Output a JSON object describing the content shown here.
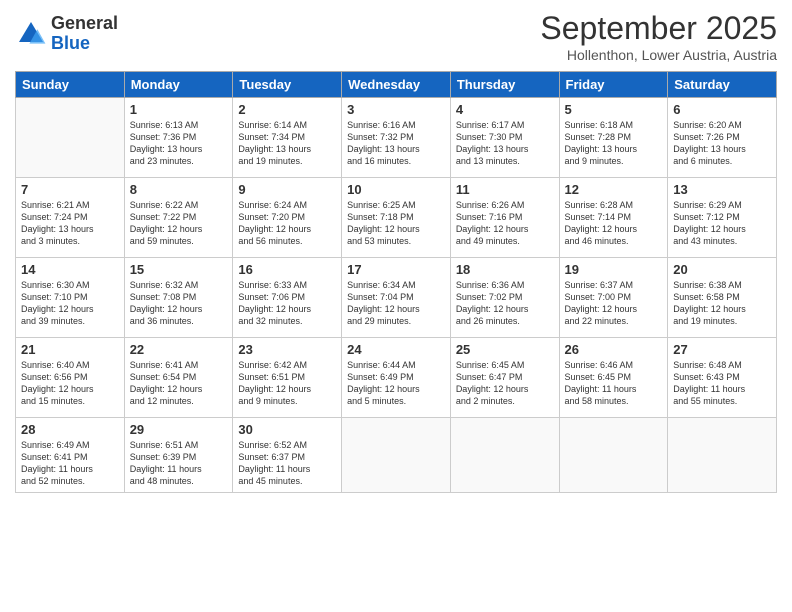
{
  "logo": {
    "general": "General",
    "blue": "Blue"
  },
  "header": {
    "month": "September 2025",
    "location": "Hollenthon, Lower Austria, Austria"
  },
  "days_header": [
    "Sunday",
    "Monday",
    "Tuesday",
    "Wednesday",
    "Thursday",
    "Friday",
    "Saturday"
  ],
  "weeks": [
    [
      {
        "day": "",
        "info": ""
      },
      {
        "day": "1",
        "info": "Sunrise: 6:13 AM\nSunset: 7:36 PM\nDaylight: 13 hours\nand 23 minutes."
      },
      {
        "day": "2",
        "info": "Sunrise: 6:14 AM\nSunset: 7:34 PM\nDaylight: 13 hours\nand 19 minutes."
      },
      {
        "day": "3",
        "info": "Sunrise: 6:16 AM\nSunset: 7:32 PM\nDaylight: 13 hours\nand 16 minutes."
      },
      {
        "day": "4",
        "info": "Sunrise: 6:17 AM\nSunset: 7:30 PM\nDaylight: 13 hours\nand 13 minutes."
      },
      {
        "day": "5",
        "info": "Sunrise: 6:18 AM\nSunset: 7:28 PM\nDaylight: 13 hours\nand 9 minutes."
      },
      {
        "day": "6",
        "info": "Sunrise: 6:20 AM\nSunset: 7:26 PM\nDaylight: 13 hours\nand 6 minutes."
      }
    ],
    [
      {
        "day": "7",
        "info": "Sunrise: 6:21 AM\nSunset: 7:24 PM\nDaylight: 13 hours\nand 3 minutes."
      },
      {
        "day": "8",
        "info": "Sunrise: 6:22 AM\nSunset: 7:22 PM\nDaylight: 12 hours\nand 59 minutes."
      },
      {
        "day": "9",
        "info": "Sunrise: 6:24 AM\nSunset: 7:20 PM\nDaylight: 12 hours\nand 56 minutes."
      },
      {
        "day": "10",
        "info": "Sunrise: 6:25 AM\nSunset: 7:18 PM\nDaylight: 12 hours\nand 53 minutes."
      },
      {
        "day": "11",
        "info": "Sunrise: 6:26 AM\nSunset: 7:16 PM\nDaylight: 12 hours\nand 49 minutes."
      },
      {
        "day": "12",
        "info": "Sunrise: 6:28 AM\nSunset: 7:14 PM\nDaylight: 12 hours\nand 46 minutes."
      },
      {
        "day": "13",
        "info": "Sunrise: 6:29 AM\nSunset: 7:12 PM\nDaylight: 12 hours\nand 43 minutes."
      }
    ],
    [
      {
        "day": "14",
        "info": "Sunrise: 6:30 AM\nSunset: 7:10 PM\nDaylight: 12 hours\nand 39 minutes."
      },
      {
        "day": "15",
        "info": "Sunrise: 6:32 AM\nSunset: 7:08 PM\nDaylight: 12 hours\nand 36 minutes."
      },
      {
        "day": "16",
        "info": "Sunrise: 6:33 AM\nSunset: 7:06 PM\nDaylight: 12 hours\nand 32 minutes."
      },
      {
        "day": "17",
        "info": "Sunrise: 6:34 AM\nSunset: 7:04 PM\nDaylight: 12 hours\nand 29 minutes."
      },
      {
        "day": "18",
        "info": "Sunrise: 6:36 AM\nSunset: 7:02 PM\nDaylight: 12 hours\nand 26 minutes."
      },
      {
        "day": "19",
        "info": "Sunrise: 6:37 AM\nSunset: 7:00 PM\nDaylight: 12 hours\nand 22 minutes."
      },
      {
        "day": "20",
        "info": "Sunrise: 6:38 AM\nSunset: 6:58 PM\nDaylight: 12 hours\nand 19 minutes."
      }
    ],
    [
      {
        "day": "21",
        "info": "Sunrise: 6:40 AM\nSunset: 6:56 PM\nDaylight: 12 hours\nand 15 minutes."
      },
      {
        "day": "22",
        "info": "Sunrise: 6:41 AM\nSunset: 6:54 PM\nDaylight: 12 hours\nand 12 minutes."
      },
      {
        "day": "23",
        "info": "Sunrise: 6:42 AM\nSunset: 6:51 PM\nDaylight: 12 hours\nand 9 minutes."
      },
      {
        "day": "24",
        "info": "Sunrise: 6:44 AM\nSunset: 6:49 PM\nDaylight: 12 hours\nand 5 minutes."
      },
      {
        "day": "25",
        "info": "Sunrise: 6:45 AM\nSunset: 6:47 PM\nDaylight: 12 hours\nand 2 minutes."
      },
      {
        "day": "26",
        "info": "Sunrise: 6:46 AM\nSunset: 6:45 PM\nDaylight: 11 hours\nand 58 minutes."
      },
      {
        "day": "27",
        "info": "Sunrise: 6:48 AM\nSunset: 6:43 PM\nDaylight: 11 hours\nand 55 minutes."
      }
    ],
    [
      {
        "day": "28",
        "info": "Sunrise: 6:49 AM\nSunset: 6:41 PM\nDaylight: 11 hours\nand 52 minutes."
      },
      {
        "day": "29",
        "info": "Sunrise: 6:51 AM\nSunset: 6:39 PM\nDaylight: 11 hours\nand 48 minutes."
      },
      {
        "day": "30",
        "info": "Sunrise: 6:52 AM\nSunset: 6:37 PM\nDaylight: 11 hours\nand 45 minutes."
      },
      {
        "day": "",
        "info": ""
      },
      {
        "day": "",
        "info": ""
      },
      {
        "day": "",
        "info": ""
      },
      {
        "day": "",
        "info": ""
      }
    ]
  ]
}
